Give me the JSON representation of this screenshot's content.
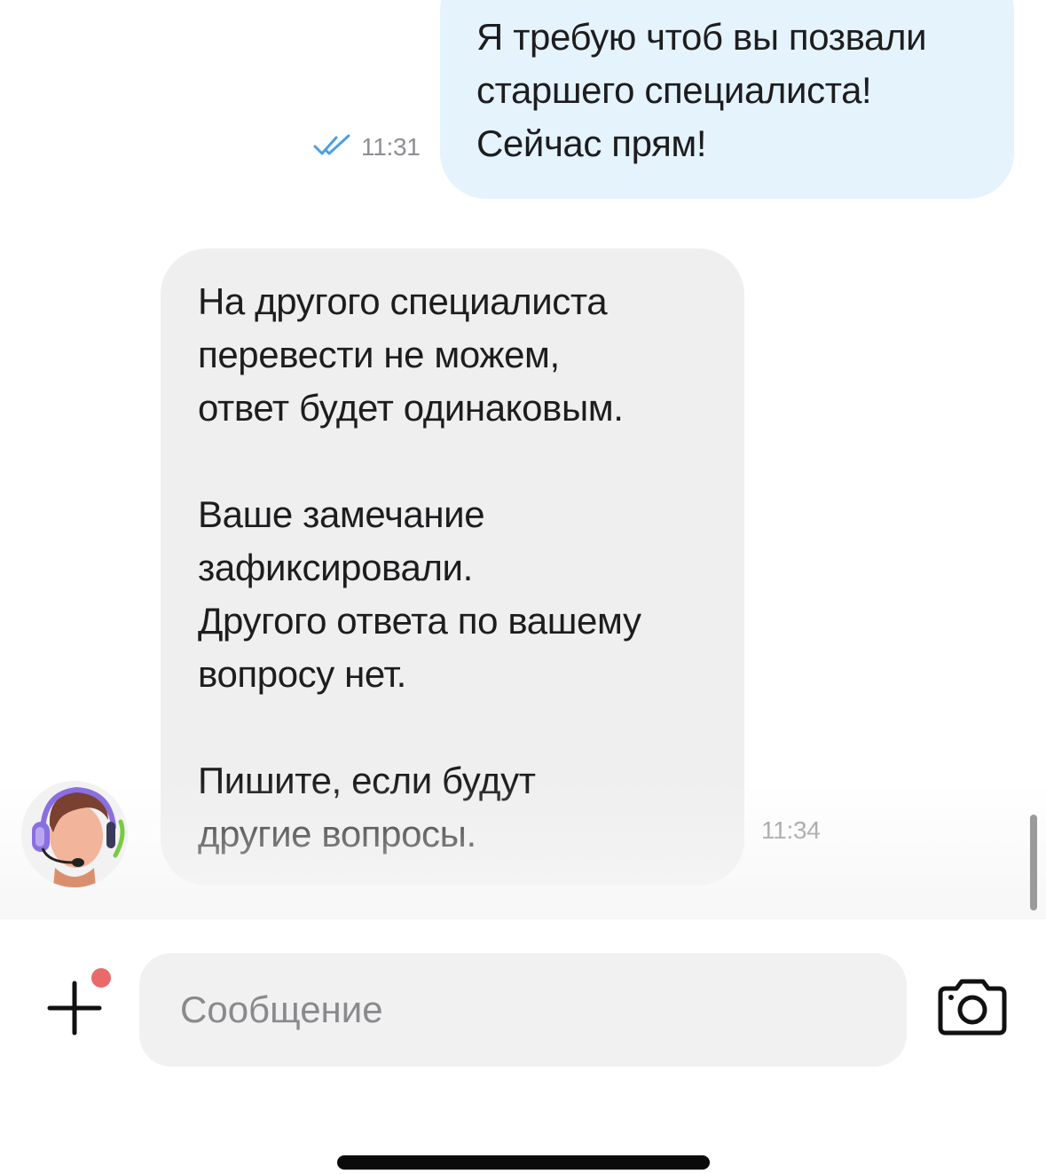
{
  "chat": {
    "messages": [
      {
        "direction": "outgoing",
        "text": "Я требую чтоб вы позвали\nстаршего специалиста!\nСейчас прям!",
        "time": "11:31",
        "status": "read",
        "status_icon": "double-check-icon",
        "bubble_color": "#e5f3fd"
      },
      {
        "direction": "incoming",
        "text": "На другого специалиста\nперевести не можем,\nответ будет одинаковым.\n\nВаше замечание\nзафиксировали.\nДругого ответа по вашему\nвопросу нет.\n\nПишите, если будут\nдругие вопросы.",
        "time": "11:34",
        "sender_avatar": "support-agent-avatar",
        "bubble_color": "#efefef"
      }
    ]
  },
  "composer": {
    "placeholder": "Сообщение",
    "value": "",
    "add_icon": "plus-icon",
    "has_notification": true,
    "notification_color": "#e96a6a",
    "camera_icon": "camera-icon"
  },
  "colors": {
    "read_check": "#4a9fe6",
    "time_text": "#8e8e93",
    "text": "#1d1d1f"
  }
}
